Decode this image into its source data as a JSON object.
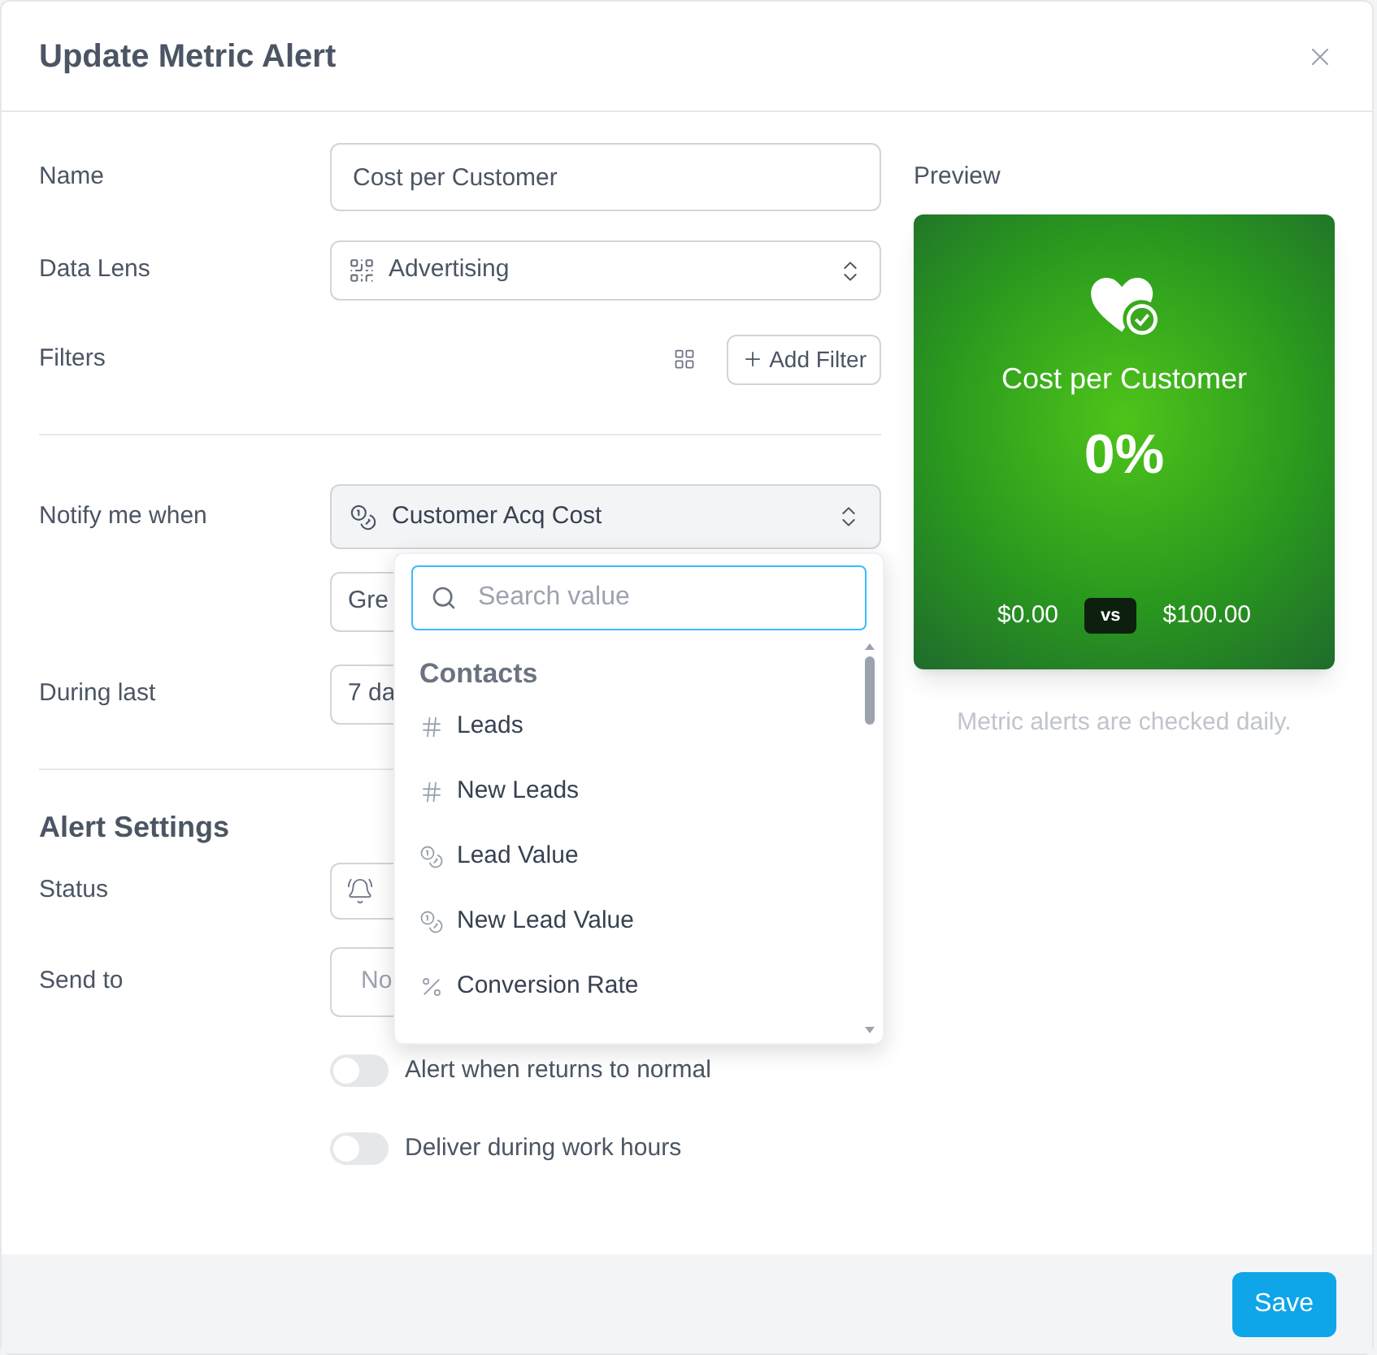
{
  "dialog": {
    "title": "Update Metric Alert"
  },
  "form": {
    "name": {
      "label": "Name",
      "value": "Cost per Customer"
    },
    "data_lens": {
      "label": "Data Lens",
      "value": "Advertising"
    },
    "filters": {
      "label": "Filters",
      "add_button": "Add Filter"
    },
    "notify": {
      "label": "Notify me when",
      "value": "Customer Acq Cost"
    },
    "condition": {
      "value": "Gre"
    },
    "during_last": {
      "label": "During last",
      "value": "7 da"
    }
  },
  "alert_settings": {
    "heading": "Alert Settings",
    "status": {
      "label": "Status"
    },
    "send_to": {
      "label": "Send to",
      "placeholder": "No"
    },
    "toggles": [
      {
        "label": "Alert when returns to normal",
        "on": false
      },
      {
        "label": "Deliver during work hours",
        "on": false
      }
    ]
  },
  "dropdown": {
    "search": {
      "placeholder": "Search value"
    },
    "group": "Contacts",
    "options": [
      {
        "label": "Leads",
        "kind": "count"
      },
      {
        "label": "New Leads",
        "kind": "count"
      },
      {
        "label": "Lead Value",
        "kind": "currency"
      },
      {
        "label": "New Lead Value",
        "kind": "currency"
      },
      {
        "label": "Conversion Rate",
        "kind": "percent"
      }
    ]
  },
  "preview": {
    "label": "Preview",
    "title": "Cost per Customer",
    "value": "0%",
    "current": "$0.00",
    "vs": "vs",
    "target": "$100.00",
    "note": "Metric alerts are checked daily."
  },
  "footer": {
    "save": "Save"
  }
}
